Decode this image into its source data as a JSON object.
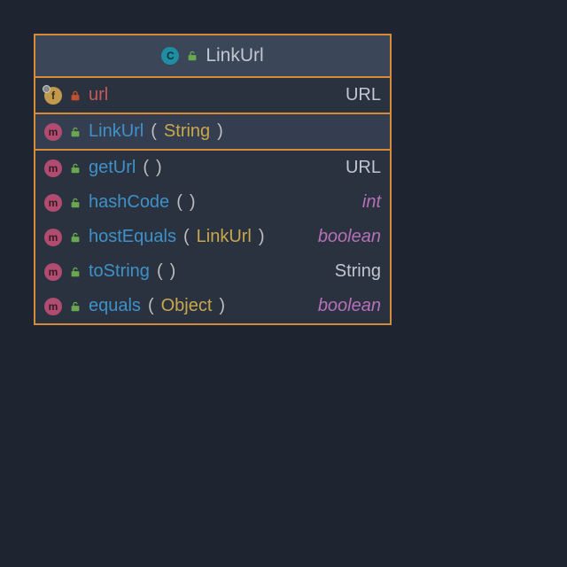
{
  "class": {
    "title": "LinkUrl",
    "icon_letter": "C",
    "visibility": "public"
  },
  "fields": [
    {
      "icon_letter": "f",
      "visibility": "private",
      "name": "url",
      "type": "URL",
      "primitive": false
    }
  ],
  "constructors": [
    {
      "icon_letter": "m",
      "visibility": "public",
      "name": "LinkUrl",
      "params": "String",
      "selected": true
    }
  ],
  "methods": [
    {
      "icon_letter": "m",
      "visibility": "public",
      "name": "getUrl",
      "params": "",
      "ret": "URL",
      "primitive": false
    },
    {
      "icon_letter": "m",
      "visibility": "public",
      "name": "hashCode",
      "params": "",
      "ret": "int",
      "primitive": true
    },
    {
      "icon_letter": "m",
      "visibility": "public",
      "name": "hostEquals",
      "params": "LinkUrl",
      "ret": "boolean",
      "primitive": true
    },
    {
      "icon_letter": "m",
      "visibility": "public",
      "name": "toString",
      "params": "",
      "ret": "String",
      "primitive": false
    },
    {
      "icon_letter": "m",
      "visibility": "public",
      "name": "equals",
      "params": "Object",
      "ret": "boolean",
      "primitive": true
    }
  ],
  "colors": {
    "lock_public": "#6aa84f",
    "lock_private": "#c05030"
  }
}
